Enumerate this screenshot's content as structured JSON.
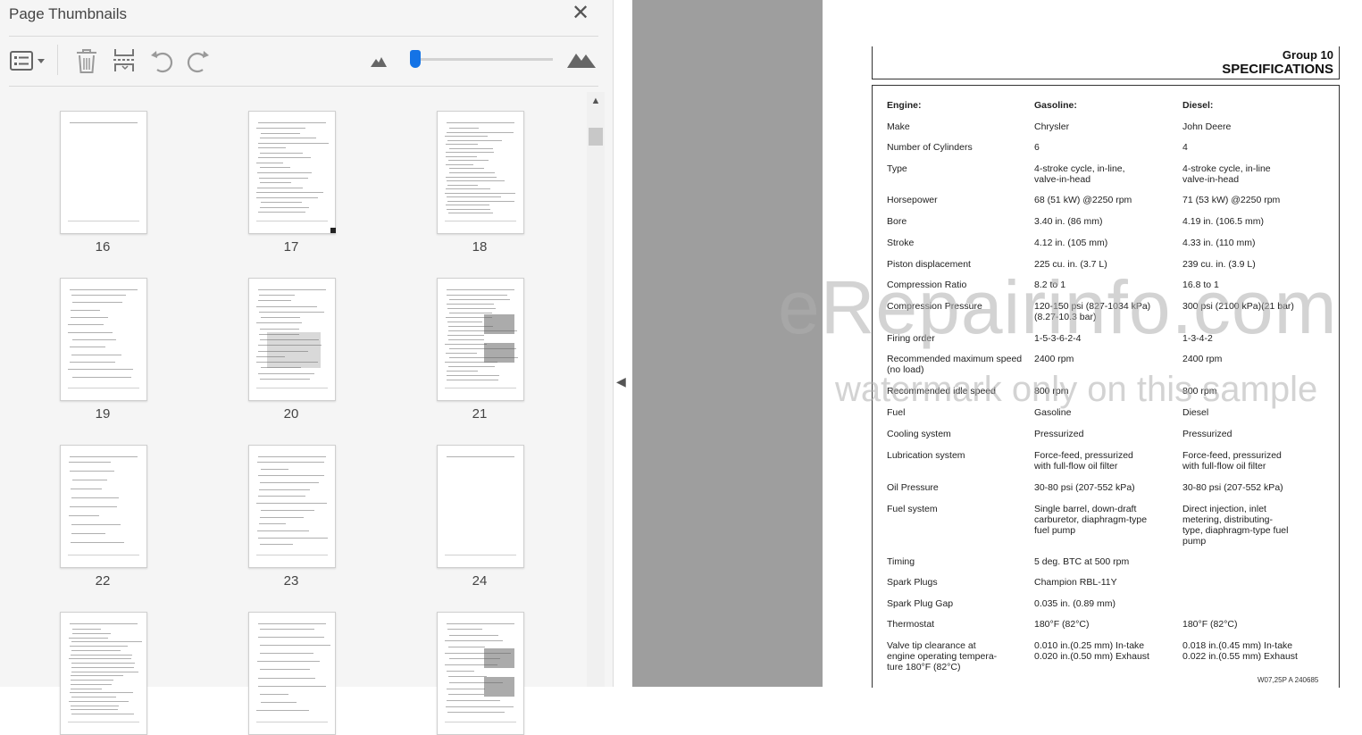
{
  "panel": {
    "title": "Page Thumbnails",
    "close_label": "✕"
  },
  "toolbar": {
    "options_icon": "options-list-icon",
    "delete_icon": "trash-icon",
    "insert_icon": "insert-pages-icon",
    "rotate_ccw_icon": "rotate-counterclockwise-icon",
    "rotate_cw_icon": "rotate-clockwise-icon",
    "zoom_out_icon": "small-mountain-icon",
    "zoom_in_icon": "large-mountain-icon",
    "zoom_level": 0.02
  },
  "thumbnails": [
    "16",
    "17",
    "18",
    "19",
    "20",
    "21",
    "22",
    "23",
    "24",
    "",
    "",
    ""
  ],
  "document": {
    "group": "Group  10",
    "section_title": "SPECIFICATIONS",
    "table": [
      [
        "Engine:",
        "Gasoline:",
        "Diesel:"
      ],
      [
        "Make",
        "Chrysler",
        "John Deere"
      ],
      [
        "Number of Cylinders",
        "6",
        "4"
      ],
      [
        "Type",
        "4-stroke cycle, in-line,\nvalve-in-head",
        "4-stroke cycle, in-line\nvalve-in-head"
      ],
      [
        "Horsepower",
        "68 (51 kW) @2250 rpm",
        "71 (53 kW) @2250 rpm"
      ],
      [
        "Bore",
        "3.40 in. (86 mm)",
        "4.19 in. (106.5 mm)"
      ],
      [
        "Stroke",
        "4.12 in. (105 mm)",
        "4.33 in. (110 mm)"
      ],
      [
        "Piston displacement",
        "225 cu. in. (3.7 L)",
        "239 cu. in. (3.9 L)"
      ],
      [
        "Compression Ratio",
        "8.2 to 1",
        "16.8 to 1"
      ],
      [
        "Compression Pressure",
        "120-150 psi (827-1034 kPa)\n(8.27-10.3 bar)",
        "300 psi (2100 kPa)(21 bar)"
      ],
      [
        "Firing order",
        "1-5-3-6-2-4",
        "1-3-4-2"
      ],
      [
        "Recommended maximum speed\n(no load)",
        "2400 rpm",
        "2400 rpm"
      ],
      [
        "Recommended idle speed",
        "800 rpm",
        "800 rpm"
      ],
      [
        "Fuel",
        "Gasoline",
        "Diesel"
      ],
      [
        "Cooling system",
        "Pressurized",
        "Pressurized"
      ],
      [
        "Lubrication system",
        "Force-feed, pressurized\nwith full-flow oil filter",
        "Force-feed, pressurized\nwith full-flow oil filter"
      ],
      [
        "Oil Pressure",
        "30-80 psi (207-552 kPa)",
        "30-80 psi (207-552 kPa)"
      ],
      [
        "Fuel system",
        "Single barrel, down-draft\ncarburetor, diaphragm-type\nfuel pump",
        "Direct injection, inlet\nmetering, distributing-\ntype, diaphragm-type fuel\npump"
      ],
      [
        "Timing",
        "5 deg. BTC at 500 rpm",
        ""
      ],
      [
        "Spark Plugs",
        "Champion RBL-11Y",
        ""
      ],
      [
        "Spark Plug Gap",
        "0.035 in. (0.89 mm)",
        ""
      ],
      [
        "Thermostat",
        "180°F (82°C)",
        "180°F (82°C)"
      ],
      [
        "Valve tip clearance at\nengine operating tempera-\nture 180°F (82°C)",
        "0.010 in.(0.25 mm) In-take\n0.020 in.(0.50 mm) Exhaust",
        "0.018 in.(0.45 mm) In-take\n0.022 in.(0.55 mm) Exhaust"
      ]
    ],
    "footer_code": "W07,25P  A  240685"
  },
  "watermark": {
    "line1": "eRepairinfo.com",
    "line2": "watermark only on this sample"
  }
}
